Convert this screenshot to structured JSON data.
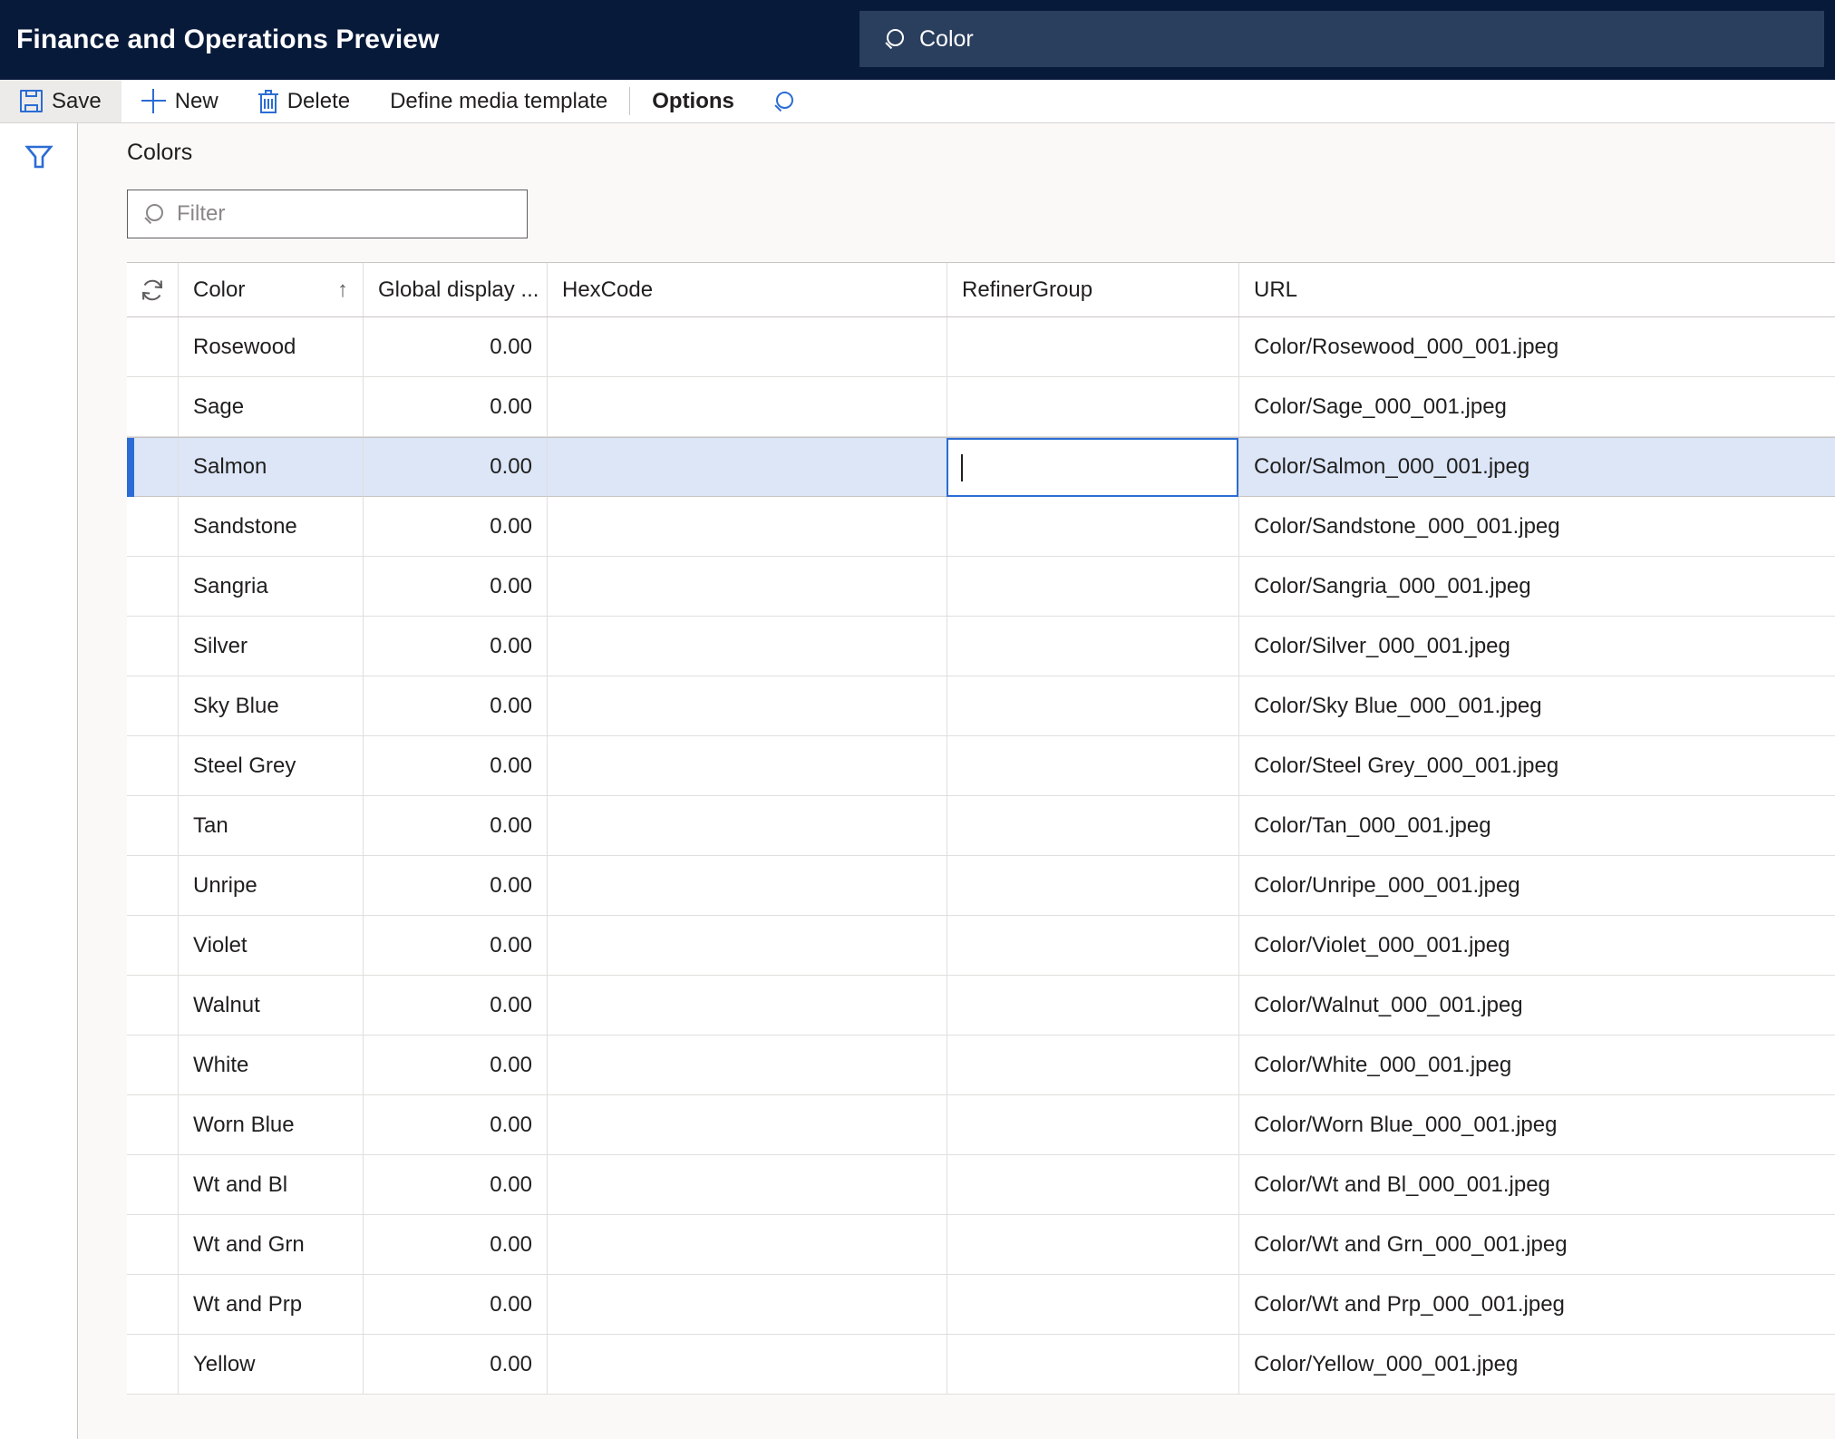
{
  "app": {
    "title": "Finance and Operations Preview",
    "search": {
      "icon": "search-icon",
      "value": "Color"
    }
  },
  "toolbar": {
    "items": [
      {
        "label": "Save",
        "icon": "save-icon",
        "active": true,
        "bold": false
      },
      {
        "label": "New",
        "icon": "plus-icon",
        "active": false,
        "bold": false
      },
      {
        "label": "Delete",
        "icon": "trash-icon",
        "active": false,
        "bold": false
      },
      {
        "label": "Define media template",
        "icon": null,
        "active": false,
        "bold": false
      },
      {
        "label": "Options",
        "icon": null,
        "active": false,
        "bold": true
      }
    ],
    "search_icon": "search-icon"
  },
  "left_rail": {
    "filter_icon": "funnel-icon"
  },
  "page": {
    "title": "Colors",
    "filter": {
      "icon": "search-icon",
      "placeholder": "Filter",
      "value": ""
    }
  },
  "grid": {
    "refresh_icon": "refresh-icon",
    "columns": [
      {
        "key": "select",
        "label": ""
      },
      {
        "key": "color",
        "label": "Color",
        "sort": "↑"
      },
      {
        "key": "global_display",
        "label": "Global display ..."
      },
      {
        "key": "hexcode",
        "label": "HexCode"
      },
      {
        "key": "refinergroup",
        "label": "RefinerGroup"
      },
      {
        "key": "url",
        "label": "URL"
      }
    ],
    "selected_row_index": 2,
    "editing": {
      "row_index": 2,
      "column": "refinergroup",
      "value": ""
    },
    "rows": [
      {
        "color": "Rosewood",
        "global_display": "0.00",
        "hexcode": "",
        "refinergroup": "",
        "url": "Color/Rosewood_000_001.jpeg"
      },
      {
        "color": "Sage",
        "global_display": "0.00",
        "hexcode": "",
        "refinergroup": "",
        "url": "Color/Sage_000_001.jpeg"
      },
      {
        "color": "Salmon",
        "global_display": "0.00",
        "hexcode": "",
        "refinergroup": "",
        "url": "Color/Salmon_000_001.jpeg"
      },
      {
        "color": "Sandstone",
        "global_display": "0.00",
        "hexcode": "",
        "refinergroup": "",
        "url": "Color/Sandstone_000_001.jpeg"
      },
      {
        "color": "Sangria",
        "global_display": "0.00",
        "hexcode": "",
        "refinergroup": "",
        "url": "Color/Sangria_000_001.jpeg"
      },
      {
        "color": "Silver",
        "global_display": "0.00",
        "hexcode": "",
        "refinergroup": "",
        "url": "Color/Silver_000_001.jpeg"
      },
      {
        "color": "Sky Blue",
        "global_display": "0.00",
        "hexcode": "",
        "refinergroup": "",
        "url": "Color/Sky Blue_000_001.jpeg"
      },
      {
        "color": "Steel Grey",
        "global_display": "0.00",
        "hexcode": "",
        "refinergroup": "",
        "url": "Color/Steel Grey_000_001.jpeg"
      },
      {
        "color": "Tan",
        "global_display": "0.00",
        "hexcode": "",
        "refinergroup": "",
        "url": "Color/Tan_000_001.jpeg"
      },
      {
        "color": "Unripe",
        "global_display": "0.00",
        "hexcode": "",
        "refinergroup": "",
        "url": "Color/Unripe_000_001.jpeg"
      },
      {
        "color": "Violet",
        "global_display": "0.00",
        "hexcode": "",
        "refinergroup": "",
        "url": "Color/Violet_000_001.jpeg"
      },
      {
        "color": "Walnut",
        "global_display": "0.00",
        "hexcode": "",
        "refinergroup": "",
        "url": "Color/Walnut_000_001.jpeg"
      },
      {
        "color": "White",
        "global_display": "0.00",
        "hexcode": "",
        "refinergroup": "",
        "url": "Color/White_000_001.jpeg"
      },
      {
        "color": "Worn Blue",
        "global_display": "0.00",
        "hexcode": "",
        "refinergroup": "",
        "url": "Color/Worn Blue_000_001.jpeg"
      },
      {
        "color": "Wt and Bl",
        "global_display": "0.00",
        "hexcode": "",
        "refinergroup": "",
        "url": "Color/Wt and Bl_000_001.jpeg"
      },
      {
        "color": "Wt and Grn",
        "global_display": "0.00",
        "hexcode": "",
        "refinergroup": "",
        "url": "Color/Wt and Grn_000_001.jpeg"
      },
      {
        "color": "Wt and Prp",
        "global_display": "0.00",
        "hexcode": "",
        "refinergroup": "",
        "url": "Color/Wt and Prp_000_001.jpeg"
      },
      {
        "color": "Yellow",
        "global_display": "0.00",
        "hexcode": "",
        "refinergroup": "",
        "url": "Color/Yellow_000_001.jpeg"
      }
    ]
  },
  "colors": {
    "appbar_bg": "#081A3A",
    "search_bg": "#2A3E5E",
    "accent": "#2B6CD4",
    "selected_row_bg": "#DCE6F7",
    "page_bg": "#FAF9F8",
    "border": "#E1DFDD"
  }
}
